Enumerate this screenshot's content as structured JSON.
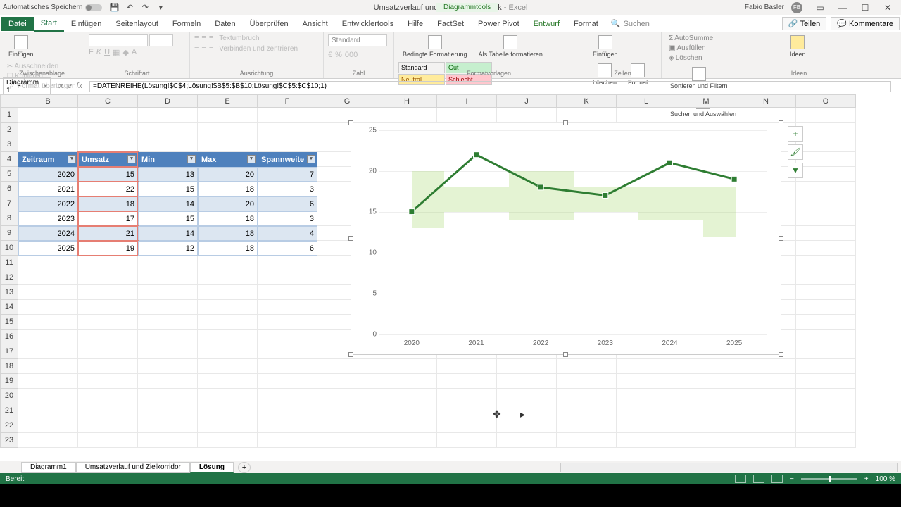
{
  "title_bar": {
    "autosave": "Automatisches Speichern",
    "doc_name": "Umsatzverlauf und Zielkorridor Grafik",
    "app_name": "Excel",
    "contextual": "Diagrammtools",
    "user": "Fabio Basler",
    "user_initials": "FB"
  },
  "tabs": {
    "file": "Datei",
    "start": "Start",
    "einfuegen": "Einfügen",
    "seitenlayout": "Seitenlayout",
    "formeln": "Formeln",
    "daten": "Daten",
    "ueberpruefen": "Überprüfen",
    "ansicht": "Ansicht",
    "entwickler": "Entwicklertools",
    "hilfe": "Hilfe",
    "factset": "FactSet",
    "powerpivot": "Power Pivot",
    "entwurf": "Entwurf",
    "format": "Format",
    "suchen": "Suchen",
    "teilen": "Teilen",
    "kommentare": "Kommentare"
  },
  "ribbon": {
    "clipboard": {
      "paste": "Einfügen",
      "cut": "Ausschneiden",
      "copy": "Kopieren",
      "format_painter": "Format übertragen",
      "label": "Zwischenablage"
    },
    "font": {
      "label": "Schriftart"
    },
    "alignment": {
      "wrap": "Textumbruch",
      "merge": "Verbinden und zentrieren",
      "label": "Ausrichtung"
    },
    "number": {
      "format": "Standard",
      "label": "Zahl"
    },
    "styles": {
      "cond": "Bedingte Formatierung",
      "as_table": "Als Tabelle formatieren",
      "standard": "Standard",
      "gut": "Gut",
      "neutral": "Neutral",
      "schlecht": "Schlecht",
      "label": "Formatvorlagen"
    },
    "cells": {
      "insert": "Einfügen",
      "delete": "Löschen",
      "format": "Format",
      "label": "Zellen"
    },
    "editing": {
      "autosum": "AutoSumme",
      "fill": "Ausfüllen",
      "clear": "Löschen",
      "sort": "Sortieren und Filtern",
      "find": "Suchen und Auswählen",
      "label": ""
    },
    "ideas": {
      "btn": "Ideen",
      "label": "Ideen"
    }
  },
  "name_box": "Diagramm 1",
  "formula": "=DATENREIHE(Lösung!$C$4;Lösung!$B$5:$B$10;Lösung!$C$5:$C$10;1)",
  "columns": [
    "B",
    "C",
    "D",
    "E",
    "F",
    "G",
    "H",
    "I",
    "J",
    "K",
    "L",
    "M",
    "N",
    "O"
  ],
  "rows": [
    "1",
    "2",
    "3",
    "4",
    "5",
    "6",
    "7",
    "8",
    "9",
    "10",
    "11",
    "12",
    "13",
    "14",
    "15",
    "16",
    "17",
    "18",
    "19",
    "20",
    "21",
    "22",
    "23"
  ],
  "table": {
    "headers": [
      "Zeitraum",
      "Umsatz",
      "Min",
      "Max",
      "Spannweite"
    ],
    "data": [
      [
        "2020",
        "15",
        "13",
        "20",
        "7"
      ],
      [
        "2021",
        "22",
        "15",
        "18",
        "3"
      ],
      [
        "2022",
        "18",
        "14",
        "20",
        "6"
      ],
      [
        "2023",
        "17",
        "15",
        "18",
        "3"
      ],
      [
        "2024",
        "21",
        "14",
        "18",
        "4"
      ],
      [
        "2025",
        "19",
        "12",
        "18",
        "6"
      ]
    ]
  },
  "chart_data": {
    "type": "line",
    "categories": [
      "2020",
      "2021",
      "2022",
      "2023",
      "2024",
      "2025"
    ],
    "series": [
      {
        "name": "Umsatz",
        "values": [
          15,
          22,
          18,
          17,
          21,
          19
        ]
      },
      {
        "name": "Min",
        "values": [
          13,
          15,
          14,
          15,
          14,
          12
        ]
      },
      {
        "name": "Max",
        "values": [
          20,
          18,
          20,
          18,
          18,
          18
        ]
      }
    ],
    "ylim": [
      0,
      25
    ],
    "y_ticks": [
      0,
      5,
      10,
      15,
      20,
      25
    ],
    "xlabel": "",
    "ylabel": "",
    "title": ""
  },
  "sheet_tabs": [
    "Diagramm1",
    "Umsatzverlauf und Zielkorridor",
    "Lösung"
  ],
  "status": {
    "ready": "Bereit",
    "zoom": "100 %"
  }
}
